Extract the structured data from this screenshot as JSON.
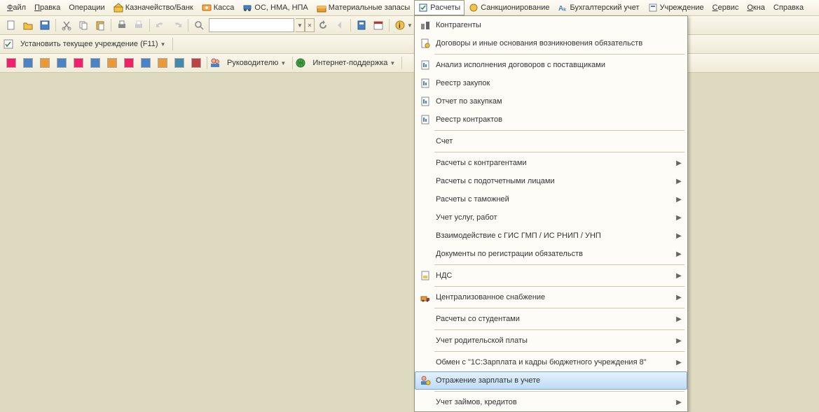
{
  "menubar": {
    "items": [
      {
        "label": "Файл",
        "underline": 0
      },
      {
        "label": "Правка",
        "underline": 0
      },
      {
        "label": "Операции"
      },
      {
        "label": "Казначейство/Банк",
        "icon": "bank-icon"
      },
      {
        "label": "Касса",
        "icon": "cash-icon"
      },
      {
        "label": "ОС, НМА, НПА",
        "icon": "assets-icon"
      },
      {
        "label": "Материальные запасы",
        "icon": "inventory-icon"
      },
      {
        "label": "Расчеты",
        "icon": "calculations-icon",
        "active": true
      },
      {
        "label": "Санкционирование",
        "icon": "sanction-icon"
      },
      {
        "label": "Бухгалтерский учет",
        "icon": "accounting-icon"
      },
      {
        "label": "Учреждение",
        "icon": "institution-icon"
      },
      {
        "label": "Сервис",
        "underline": 0
      },
      {
        "label": "Окна",
        "underline": 0
      },
      {
        "label": "Справка"
      }
    ]
  },
  "toolbar1": {
    "set_institution": "Установить текущее учреждение (F11)"
  },
  "toolbar2": {
    "manager": "Руководителю",
    "internet_support": "Интернет-поддержка"
  },
  "dropdown": {
    "items": [
      {
        "label": "Контрагенты",
        "icon": "counteragents-icon"
      },
      {
        "label": "Договоры и иные основания возникновения обязательств",
        "icon": "contracts-icon"
      },
      {
        "sep": true
      },
      {
        "label": "Анализ исполнения договоров с поставщиками",
        "icon": "report-icon"
      },
      {
        "label": "Реестр закупок",
        "icon": "report-icon"
      },
      {
        "label": "Отчет по закупкам",
        "icon": "report-icon"
      },
      {
        "label": "Реестр контрактов",
        "icon": "report-icon"
      },
      {
        "sep": true
      },
      {
        "label": "Счет"
      },
      {
        "sep": true
      },
      {
        "label": "Расчеты с контрагентами",
        "submenu": true
      },
      {
        "label": "Расчеты с подотчетными лицами",
        "submenu": true
      },
      {
        "label": "Расчеты с таможней",
        "submenu": true
      },
      {
        "label": "Учет услуг, работ",
        "submenu": true
      },
      {
        "label": "Взаимодействие с ГИС ГМП / ИС РНИП / УНП",
        "submenu": true
      },
      {
        "label": "Документы по регистрации обязательств",
        "submenu": true
      },
      {
        "sep": true
      },
      {
        "label": "НДС",
        "icon": "nds-icon",
        "submenu": true
      },
      {
        "sep": true
      },
      {
        "label": "Централизованное снабжение",
        "icon": "supply-icon",
        "submenu": true
      },
      {
        "sep": true
      },
      {
        "label": "Расчеты со студентами",
        "submenu": true
      },
      {
        "sep": true
      },
      {
        "label": "Учет родительской платы",
        "submenu": true
      },
      {
        "sep": true
      },
      {
        "label": "Обмен с \"1С:Зарплата и кадры бюджетного учреждения 8\"",
        "submenu": true
      },
      {
        "label": "Отражение зарплаты в учете",
        "icon": "salary-icon",
        "highlight": true
      },
      {
        "sep": true
      },
      {
        "label": "Учет займов, кредитов",
        "submenu": true
      }
    ]
  }
}
